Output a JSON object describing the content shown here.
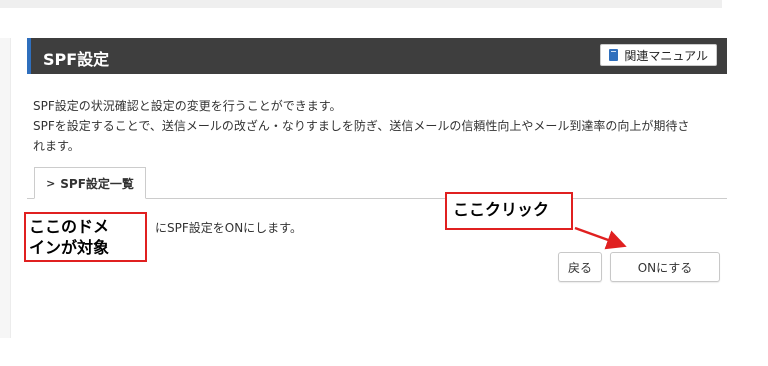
{
  "panel": {
    "title": "SPF設定",
    "manual_label": "関連マニュアル"
  },
  "description": {
    "line1": "SPF設定の状況確認と設定の変更を行うことができます。",
    "line2": "SPFを設定することで、送信メールの改ざん・なりすましを防ぎ、送信メールの信頼性向上やメール到達率の向上が期待さ",
    "line3": "れます。"
  },
  "tabs": [
    {
      "label": "SPF設定一覧",
      "active": true
    }
  ],
  "message": "にSPF設定をONにします。",
  "buttons": {
    "back": "戻る",
    "on": "ONにする"
  },
  "annotations": {
    "domain_line1": "ここのドメ",
    "domain_line2": "インが対象",
    "click": "ここクリック",
    "color": "#e02020"
  },
  "colors": {
    "header_bg": "#3e3e3e",
    "accent": "#2f6fbd"
  },
  "icons": {
    "manual": "book-icon",
    "tab": "chevron-right-icon"
  }
}
